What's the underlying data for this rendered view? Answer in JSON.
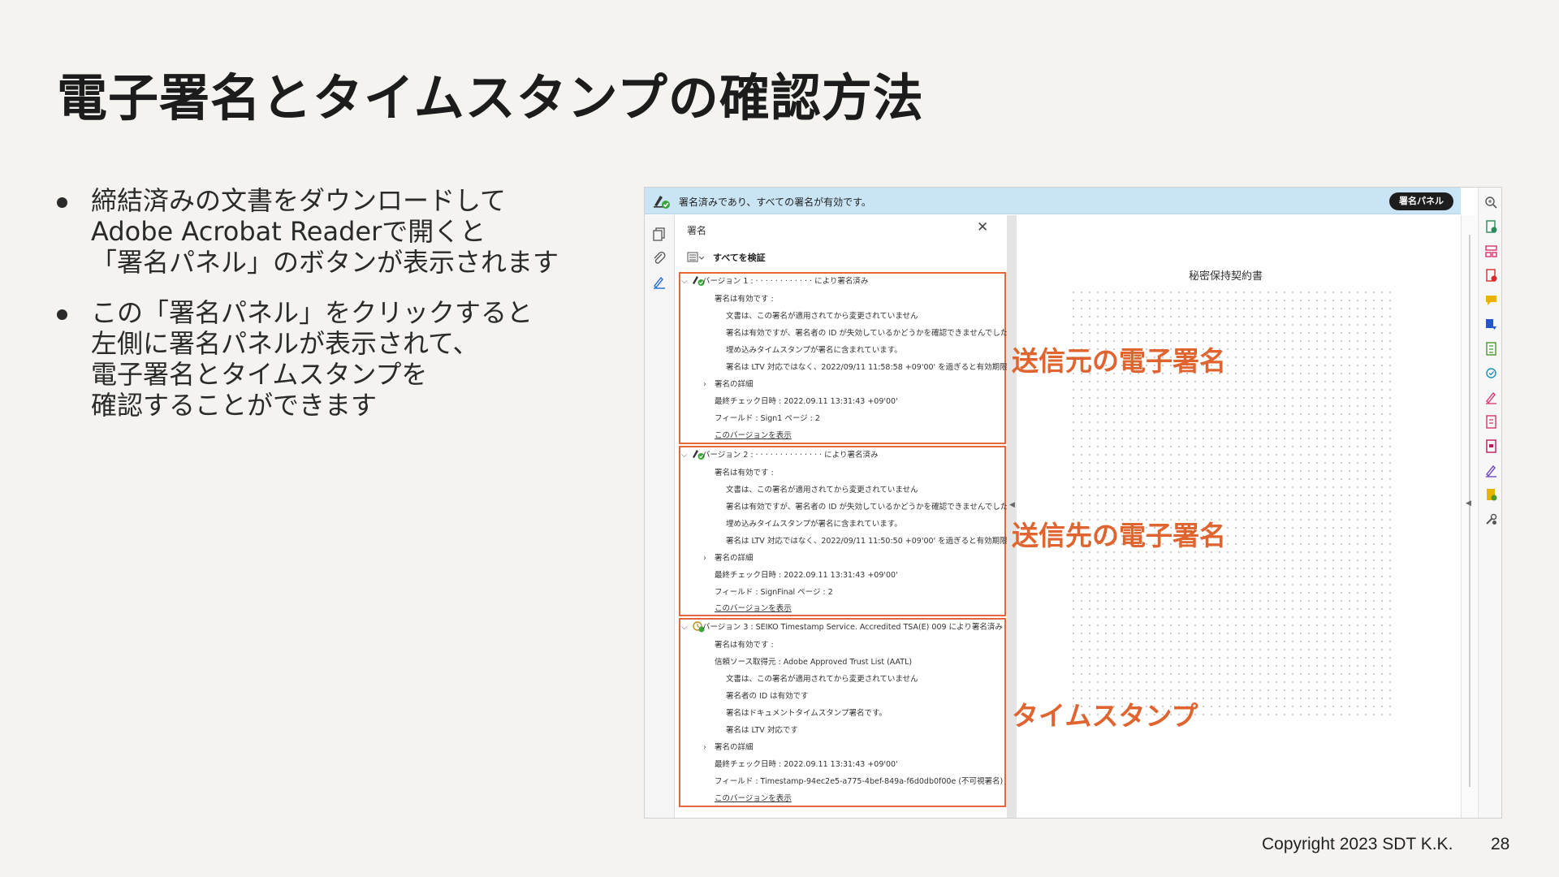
{
  "slide": {
    "title": "電子署名とタイムスタンプの確認方法",
    "bullets": [
      {
        "lines": [
          "締結済みの文書をダウンロードして",
          "Adobe Acrobat Readerで開くと",
          "「署名パネル」のボタンが表示されます"
        ]
      },
      {
        "lines": [
          "この「署名パネル」をクリックすると",
          "左側に署名パネルが表示されて、",
          "電子署名とタイムスタンプを",
          "確認することができます"
        ]
      }
    ],
    "copyright": "Copyright 2023 SDT K.K.",
    "page_number": "28"
  },
  "screenshot": {
    "topbar": {
      "message": "署名済みであり、すべての署名が有効です。",
      "signature_panel_button": "署名パネル"
    },
    "panel": {
      "title": "署名",
      "close_glyph": "✕",
      "verify_all": "すべてを検証",
      "versions": [
        {
          "header": "バージョン 1 : · · · · · · · · · · · · により署名済み",
          "rows": [
            "署名は有効です :",
            "文書は、この署名が適用されてから変更されていません",
            "署名は有効ですが、署名者の ID が失効しているかどうかを確認できませんでした",
            "埋め込みタイムスタンプが署名に含まれています。",
            "署名は LTV 対応ではなく、2022/09/11 11:58:58 +09'00' を過ぎると有効期限が切れます"
          ],
          "details": "署名の詳細",
          "last_checked": "最終チェック日時 : 2022.09.11 13:31:43 +09'00'",
          "field": "フィールド : Sign1 ページ : 2",
          "show_version": "このバージョンを表示"
        },
        {
          "header": "バージョン 2 : · · · · · · · · · · · · · · により署名済み",
          "rows": [
            "署名は有効です :",
            "文書は、この署名が適用されてから変更されていません",
            "署名は有効ですが、署名者の ID が失効しているかどうかを確認できませんでした",
            "埋め込みタイムスタンプが署名に含まれています。",
            "署名は LTV 対応ではなく、2022/09/11 11:50:50 +09'00' を過ぎると有効期限が切れます"
          ],
          "details": "署名の詳細",
          "last_checked": "最終チェック日時 : 2022.09.11 13:31:43 +09'00'",
          "field": "フィールド : SignFinal ページ : 2",
          "show_version": "このバージョンを表示"
        },
        {
          "header": "バージョン 3 : SEIKO Timestamp Service. Accredited TSA(E) 009 により署名済み",
          "rows": [
            "署名は有効です :",
            "信頼ソース取得元 : Adobe Approved Trust List (AATL)",
            "文書は、この署名が適用されてから変更されていません",
            "署名者の ID は有効です",
            "署名はドキュメントタイムスタンプ署名です。",
            "署名は LTV 対応です"
          ],
          "details": "署名の詳細",
          "last_checked": "最終チェック日時 : 2022.09.11 13:31:43 +09'00'",
          "field": "フィールド : Timestamp-94ec2e5-a775-4bef-849a-f6d0db0f00e (不可視署名)",
          "show_version": "このバージョンを表示"
        }
      ]
    },
    "document": {
      "title": "秘密保持契約書"
    }
  },
  "callouts": {
    "sender": "送信元の電子署名",
    "recipient": "送信先の電子署名",
    "timestamp": "タイムスタンプ"
  },
  "colors": {
    "accent": "#e0642f",
    "topbar": "#c9e4f4",
    "ok_green": "#3aa53a"
  }
}
